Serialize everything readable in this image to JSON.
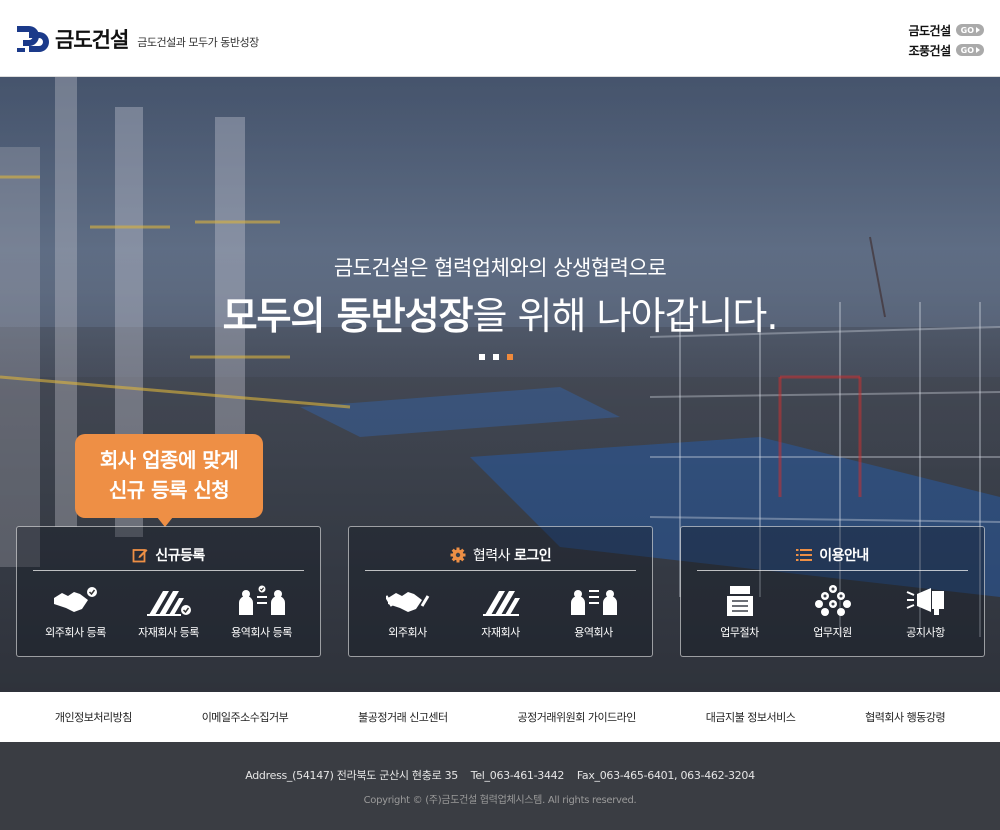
{
  "header": {
    "logo_name": "금도건설",
    "logo_slogan": "금도건설과 모두가 동반성장",
    "quick_links": [
      {
        "label": "금도건설",
        "badge": "GO"
      },
      {
        "label": "조풍건설",
        "badge": "GO"
      }
    ]
  },
  "hero": {
    "subtitle": "금도건설은 협력업체와의 상생협력으로",
    "title_bold": "모두의 동반성장",
    "title_rest": "을 위해 나아갑니다.",
    "slide_count": 3,
    "active_slide": 3
  },
  "tooltip": {
    "line1": "회사 업종에 맞게",
    "line2": "신규 등록 신청"
  },
  "panels": [
    {
      "title": "신규등록",
      "title_bold": true,
      "icon": "edit-icon",
      "items": [
        {
          "label": "외주회사 등록",
          "icon": "handshake-check-icon"
        },
        {
          "label": "자재회사 등록",
          "icon": "steel-check-icon"
        },
        {
          "label": "용역회사 등록",
          "icon": "workers-check-icon"
        }
      ]
    },
    {
      "title_prefix": "협력사",
      "title": "로그인",
      "icon": "gear-icon",
      "items": [
        {
          "label": "외주회사",
          "icon": "handshake-icon"
        },
        {
          "label": "자재회사",
          "icon": "steel-icon"
        },
        {
          "label": "용역회사",
          "icon": "workers-icon"
        }
      ]
    },
    {
      "title": "이용안내",
      "title_bold": true,
      "icon": "list-icon",
      "items": [
        {
          "label": "업무절차",
          "icon": "document-icon"
        },
        {
          "label": "업무지원",
          "icon": "network-icon"
        },
        {
          "label": "공지사항",
          "icon": "megaphone-icon"
        }
      ]
    }
  ],
  "footer_links": [
    "개인정보처리방침",
    "이메일주소수집거부",
    "불공정거래 신고센터",
    "공정거래위원회 가이드라인",
    "대금지불 정보서비스",
    "협력회사 행동강령"
  ],
  "bottom": {
    "address": "Address_(54147) 전라북도 군산시 현충로 35    Tel_063-461-3442    Fax_063-465-6401, 063-462-3204",
    "copyright": "Copyright © (주)금도건설 협력업체시스템. All rights reserved."
  },
  "colors": {
    "accent_orange": "#ee8f45",
    "brand_navy": "#1b3a8a",
    "footer_bg": "#3a3d43"
  }
}
